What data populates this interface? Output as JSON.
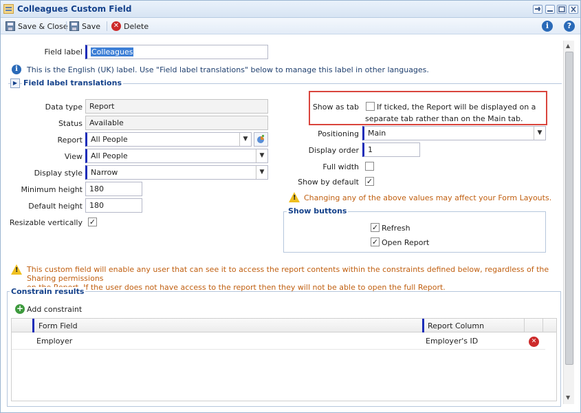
{
  "window": {
    "title": "Colleagues Custom Field"
  },
  "toolbar": {
    "save_close_label": "Save & Close",
    "save_label": "Save",
    "delete_label": "Delete"
  },
  "field_label": {
    "label": "Field label",
    "value": "Colleagues",
    "info": "This is the English (UK) label. Use \"Field label translations\" below to manage this label in other languages."
  },
  "translations": {
    "label": "Field label translations"
  },
  "left": {
    "data_type": {
      "label": "Data type",
      "value": "Report"
    },
    "status": {
      "label": "Status",
      "value": "Available"
    },
    "report": {
      "label": "Report",
      "value": "All People"
    },
    "view": {
      "label": "View",
      "value": "All People"
    },
    "display_style": {
      "label": "Display style",
      "value": "Narrow"
    },
    "min_height": {
      "label": "Minimum height",
      "value": "180"
    },
    "default_height": {
      "label": "Default height",
      "value": "180"
    },
    "resizable": {
      "label": "Resizable vertically",
      "checked": true
    }
  },
  "right": {
    "show_as_tab": {
      "label": "Show as tab",
      "checked": false,
      "hint_line1": "If ticked, the Report will be displayed on a",
      "hint_line2": "separate tab rather than on the Main tab."
    },
    "positioning": {
      "label": "Positioning",
      "value": "Main"
    },
    "display_order": {
      "label": "Display order",
      "value": "1"
    },
    "full_width": {
      "label": "Full width",
      "checked": false
    },
    "show_by_default": {
      "label": "Show by default",
      "checked": true
    },
    "warning": "Changing any of the above values may affect your Form Layouts."
  },
  "show_buttons": {
    "legend": "Show buttons",
    "refresh": {
      "label": "Refresh",
      "checked": true
    },
    "open_report": {
      "label": "Open Report",
      "checked": true
    }
  },
  "access_warning": {
    "line1": "This custom field will enable any user that can see it to access the report contents within the constraints defined below, regardless of the Sharing permissions",
    "line2": "on the Report. If the user does not have access to the report then they will not be able to open the full Report."
  },
  "constrain": {
    "legend": "Constrain results",
    "add_label": "Add constraint",
    "columns": [
      "Form Field",
      "Report Column"
    ],
    "rows": [
      {
        "form_field": "Employer",
        "report_column": "Employer's ID"
      }
    ]
  },
  "colors": {
    "accent": "#15428b",
    "highlight_box": "#d9443c",
    "warning_text": "#c05f10"
  }
}
